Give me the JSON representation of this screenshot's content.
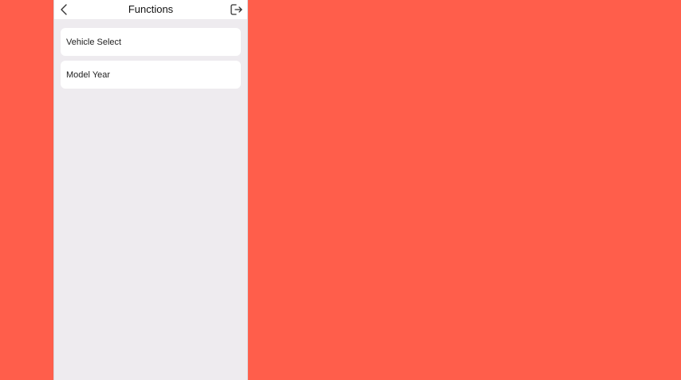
{
  "header": {
    "title": "Functions",
    "back_icon": "chevron-left-icon",
    "exit_icon": "exit-icon"
  },
  "menu": {
    "items": [
      {
        "label": "Vehicle Select"
      },
      {
        "label": "Model Year"
      }
    ]
  },
  "colors": {
    "background": "#ff5e4b",
    "panel": "#eeebef",
    "card": "#ffffff"
  }
}
